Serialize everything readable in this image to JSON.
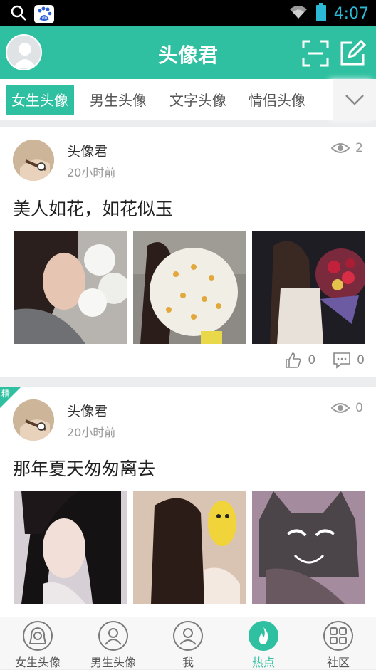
{
  "status_bar": {
    "time": "4:07",
    "search_icon": "search-icon",
    "app_icon": "baidu-paw-icon",
    "app_icon_label": "du"
  },
  "header": {
    "title": "头像君",
    "scan_icon": "scan-icon",
    "edit_icon": "edit-icon"
  },
  "tabs": {
    "items": [
      {
        "label": "女生头像"
      },
      {
        "label": "男生头像"
      },
      {
        "label": "文字头像"
      },
      {
        "label": "情侣头像"
      }
    ],
    "more_icon": "chevron-down-icon"
  },
  "posts": [
    {
      "author": "头像君",
      "time": "20小时前",
      "views": "2",
      "title": "美人如花，如花似玉",
      "likes": "0",
      "comments": "0",
      "featured": false
    },
    {
      "author": "头像君",
      "time": "20小时前",
      "views": "0",
      "title": "那年夏天匆匆离去",
      "featured": true,
      "featured_label": "精"
    }
  ],
  "bottom_nav": {
    "items": [
      {
        "label": "女生头像"
      },
      {
        "label": "男生头像"
      },
      {
        "label": "我"
      },
      {
        "label": "热点"
      },
      {
        "label": "社区"
      }
    ]
  },
  "colors": {
    "accent": "#2ec0a0",
    "status_bar": "#000000"
  }
}
